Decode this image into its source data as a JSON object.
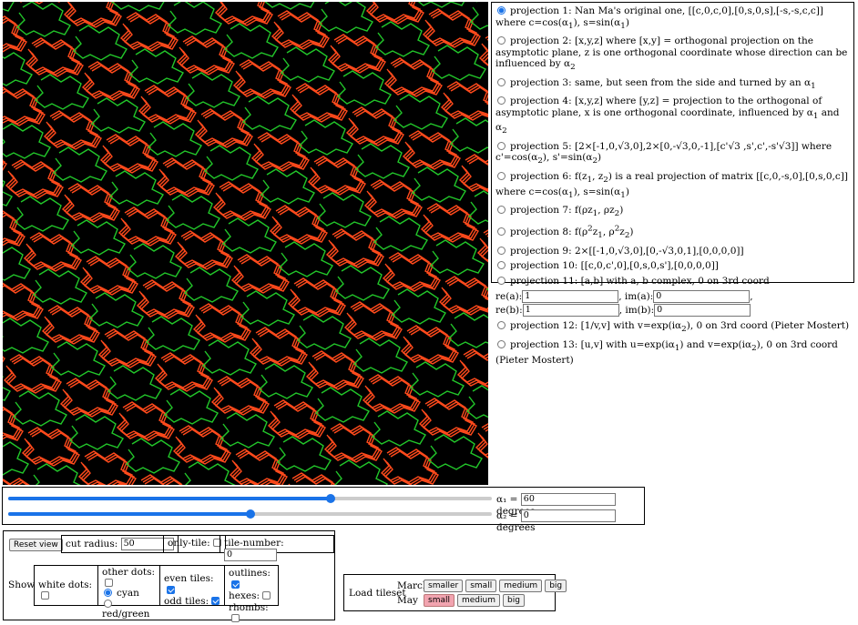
{
  "projections": [
    {
      "html": "projection 1: Nan Ma's original one, [[c,0,c,0],[0,s,0,s],[-s,-s,c,c]] where c=cos(α<sub>1</sub>), s=sin(α<sub>1</sub>)",
      "checked": true
    },
    {
      "html": "projection 2: [x,y,z] where [x,y] = orthogonal projection on the asymptotic plane, z is one orthogonal coordinate whose direction can be influenced by α<sub>2</sub>",
      "checked": false
    },
    {
      "html": "projection 3: same, but seen from the side and turned by an α<sub>1</sub>",
      "checked": false
    },
    {
      "html": "projection 4: [x,y,z] where [y,z] = projection to the orthogonal of asymptotic plane, x is one orthogonal coordinate, influenced by α<sub>1</sub> and α<sub>2</sub>",
      "checked": false
    },
    {
      "html": "projection 5: [2×[-1,0,√3,0],2×[0,-√3,0,-1],[c'√3 ,s',c',-s'√3]] where c'=cos(α<sub>2</sub>), s'=sin(α<sub>2</sub>)",
      "checked": false
    },
    {
      "html": "projection 6: f(z<sub>1</sub>, z<sub>2</sub>) is a real projection of matrix [[c,0,-s,0],[0,s,0,c]] where c=cos(α<sub>1</sub>), s=sin(α<sub>1</sub>)",
      "checked": false
    },
    {
      "html": "projection 7: f(ρz<sub>1</sub>, ρz<sub>2</sub>)",
      "checked": false
    },
    {
      "html": "projection 8: f(ρ<sup>2</sup>z<sub>1</sub>, ρ<sup>2</sup>z<sub>2</sub>)",
      "checked": false
    },
    {
      "html": "projection 9: 2×[[-1,0,√3,0],[0,-√3,0,1],[0,0,0,0]]",
      "checked": false
    },
    {
      "html": "projection 10: [[c,0,c',0],[0,s,0,s'],[0,0,0,0]]",
      "checked": false
    },
    {
      "html": "projection 11: [a,b] with a, b complex, 0 on 3rd coord",
      "checked": false
    },
    {
      "html": "projection 12: [1/v,v] with v=exp(iα<sub>2</sub>), 0 on 3rd coord (Pieter Mostert)",
      "checked": false
    },
    {
      "html": "projection 13: [u,v] with u=exp(iα<sub>1</sub>) and v=exp(iα<sub>2</sub>), 0 on 3rd coord (Pieter Mostert)",
      "checked": false
    }
  ],
  "complex": {
    "re_a_label": "re(a):",
    "re_a": "1",
    "im_a_label": ", im(a):",
    "im_a": "0",
    "re_b_label": "re(b):",
    "re_b": "1",
    "im_b_label": ", im(b):",
    "im_b": "0"
  },
  "sliders": {
    "alpha1": {
      "label": "α₁ =",
      "value": "60",
      "unit": "degrees",
      "fraction": 0.667
    },
    "alpha2": {
      "label": "α₂ =",
      "value": "0",
      "unit": "degrees",
      "fraction": 0.5
    }
  },
  "controls": {
    "reset": "Reset view",
    "cut_radius_label": "cut radius:",
    "cut_radius": "50",
    "only_tile_label": "only-tile:",
    "tile_number_label": "tile-number:",
    "tile_number": "0",
    "show_label": "Show",
    "white_dots": "white dots:",
    "other_dots": "other dots:",
    "cyan": "cyan",
    "red_green": "red/green",
    "even_tiles": "even tiles:",
    "odd_tiles": "odd tiles:",
    "outlines": "outlines:",
    "hexes": "hexes:",
    "rhombs": "rhombs:"
  },
  "tileset": {
    "label": "Load tileset",
    "march": "March",
    "may": "May",
    "march_buttons": [
      "smaller",
      "small",
      "medium",
      "big"
    ],
    "may_buttons": [
      "small",
      "medium",
      "big"
    ]
  },
  "colors": {
    "canvas": "#000000",
    "tile_odd": "#ff4a1c",
    "tile_even": "#22c62a",
    "accent": "#1a73e8"
  }
}
